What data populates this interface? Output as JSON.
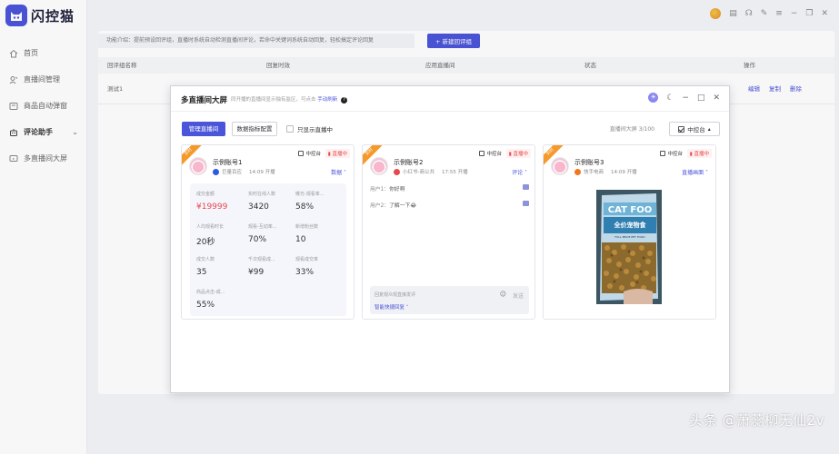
{
  "app": {
    "name": "闪控猫"
  },
  "sidebar": {
    "items": [
      {
        "label": "首页",
        "icon": "home-icon"
      },
      {
        "label": "直播间管理",
        "icon": "person-manage-icon"
      },
      {
        "label": "商品自动弹窗",
        "icon": "popup-icon"
      },
      {
        "label": "评论助手",
        "icon": "robot-icon"
      },
      {
        "label": "多直播间大屏",
        "icon": "screen-icon"
      }
    ]
  },
  "background": {
    "intro": "功能介绍：提前预设回评组，直播时系统自动检测直播间评论，若命中关键词系统自动回复，轻松搞定评论回复",
    "new_button": "+ 新建回评组",
    "columns": [
      "回评组名称",
      "回复时效",
      "应用直播间",
      "状态",
      "操作"
    ],
    "row": {
      "name": "测试1",
      "actions": [
        "编辑",
        "复制",
        "删除"
      ]
    }
  },
  "modal": {
    "title": "多直播间大屏",
    "desc_prefix": "同开播的直播间显示独有监区，可点击",
    "desc_link": "手动刷新",
    "manage_button": "管理直播间",
    "metrics_button": "数据指标配置",
    "only_live_label": "只显示直播中",
    "screen_count": "直播间大屏 3/100",
    "control_button": "中控台"
  },
  "cards": [
    {
      "ribbon": "实时",
      "console_label": "中控台",
      "live_badge": "直播中",
      "name": "示例账号1",
      "platform": "巨量百应",
      "platform_color": "#2b59e8",
      "time": "14:09 开播",
      "dropdown": "数据",
      "metrics": [
        {
          "label": "成交金额",
          "value": "¥19999",
          "red": true
        },
        {
          "label": "实时在线人数",
          "value": "3420"
        },
        {
          "label": "曝光-观看率...",
          "value": "58%"
        },
        {
          "label": "人均观看时长",
          "value": "20秒"
        },
        {
          "label": "观看-互动率...",
          "value": "70%"
        },
        {
          "label": "新增粉丝数",
          "value": "10"
        },
        {
          "label": "成交人数",
          "value": "35"
        },
        {
          "label": "千次观看成...",
          "value": "¥99"
        },
        {
          "label": "观看成交率",
          "value": "33%"
        },
        {
          "label": "商品点击-成...",
          "value": "55%"
        }
      ]
    },
    {
      "ribbon": "实时",
      "console_label": "中控台",
      "live_badge": "直播中",
      "name": "示例账号2",
      "platform": "小红书-商公共",
      "platform_color": "#e5484d",
      "time": "17:55 开播",
      "dropdown": "评论",
      "comments": [
        {
          "user": "用户1：",
          "text": "你好啊"
        },
        {
          "user": "用户2：",
          "text": "了解一下😂"
        }
      ],
      "input_placeholder": "回复观众观直接发评",
      "send": "发送",
      "smart_reply": "智能快捷回复"
    },
    {
      "ribbon": "实时",
      "console_label": "中控台",
      "live_badge": "直播中",
      "name": "示例账号3",
      "platform": "快手电商",
      "platform_color": "#f2761e",
      "time": "14:09 开播",
      "dropdown": "直播画面",
      "product_text_1": "CAT FOO",
      "product_text_2": "全价宠物食",
      "product_text_3": "FULL PRICE PET FOOD"
    }
  ],
  "watermark": "头条 @萧蕊柳无仙2v",
  "colors": {
    "brand": "#4b55d9",
    "live": "#e5484d",
    "ribbon": "#f59a2a"
  }
}
